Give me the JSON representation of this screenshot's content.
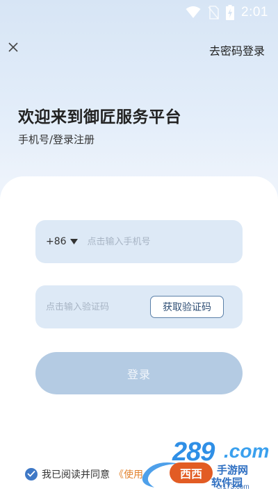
{
  "status_bar": {
    "time": "2:01",
    "icons": [
      "wifi-icon",
      "no-sim-icon",
      "battery-charging-icon"
    ]
  },
  "header": {
    "close_icon": "close-icon",
    "password_login_label": "去密码登录"
  },
  "welcome": {
    "title": "欢迎来到御匠服务平台",
    "subtitle": "手机号/登录注册"
  },
  "form": {
    "country_code": "+86",
    "phone_placeholder": "点击输入手机号",
    "code_placeholder": "点击输入验证码",
    "get_code_label": "获取验证码",
    "login_label": "登录"
  },
  "agreement": {
    "checked": true,
    "text": "我已阅读并同意",
    "link_text": "《使用"
  },
  "watermark": {
    "number": "289",
    "domain": ".com",
    "cn_text_1": "手游网",
    "cn_text_2": "软件园",
    "badge": "西西",
    "url": "cr173.com"
  },
  "colors": {
    "accent": "#3e78c6",
    "link": "#e2832f",
    "field_bg": "#dde9f6",
    "login_bg": "#b4cbe3"
  }
}
